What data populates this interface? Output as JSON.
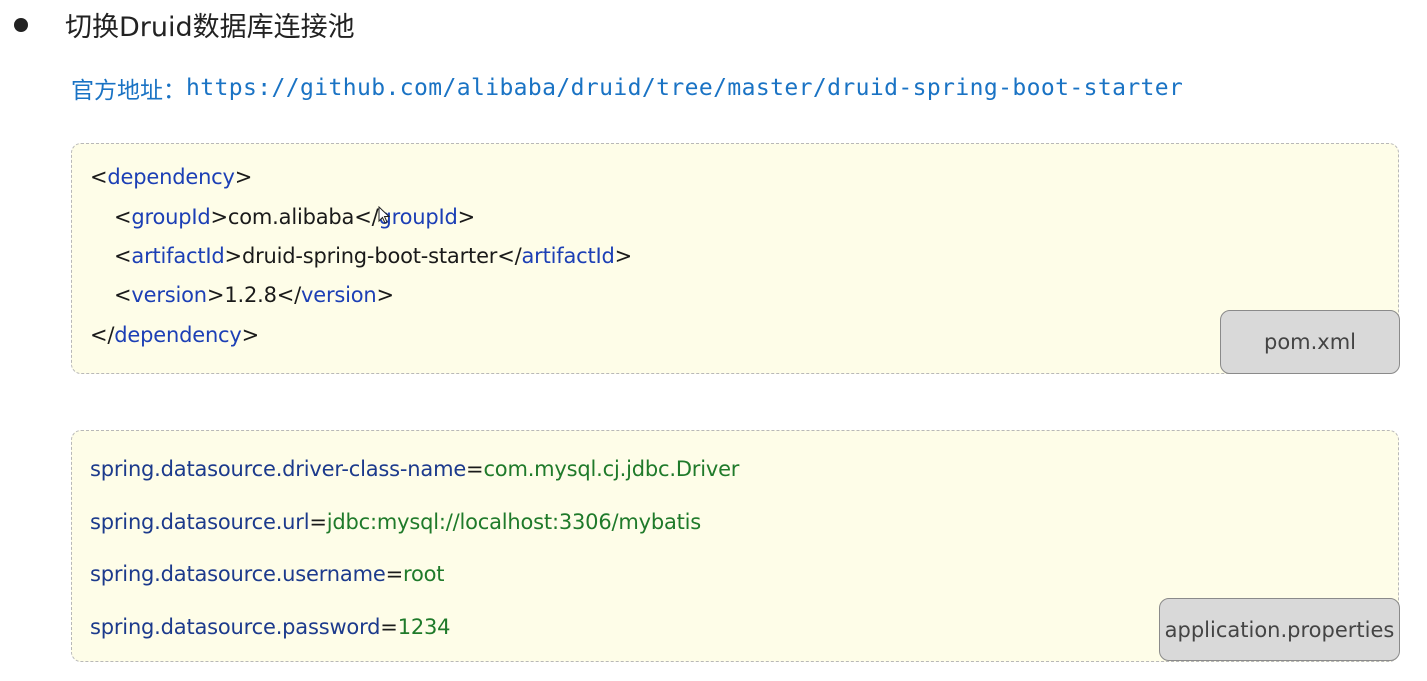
{
  "heading": {
    "text": "切换Druid数据库连接池"
  },
  "address": {
    "label": "官方地址：",
    "url": "https://github.com/alibaba/druid/tree/master/druid-spring-boot-starter"
  },
  "pom_block": {
    "file_label": "pom.xml",
    "lines": {
      "l1": {
        "open": "<",
        "tag": "dependency",
        "close": ">"
      },
      "l2": {
        "open": "<",
        "tag": "groupId",
        "mid": ">com.alibaba</",
        "tag2": "groupId",
        "close": ">"
      },
      "l3": {
        "open": "<",
        "tag": "artifactId",
        "mid": ">druid-spring-boot-starter</",
        "tag2": "artifactId",
        "close": ">"
      },
      "l4": {
        "open": "<",
        "tag": "version",
        "mid": ">1.2.8</",
        "tag2": "version",
        "close": ">"
      },
      "l5": {
        "open": "</",
        "tag": "dependency",
        "close": ">"
      }
    }
  },
  "properties_block": {
    "file_label": "application.properties",
    "lines": {
      "p1": {
        "key": "spring.datasource.driver-class-name",
        "eq": "=",
        "value": "com.mysql.cj.jdbc.Driver"
      },
      "p2": {
        "key": "spring.datasource.url",
        "eq": "=",
        "value": "jdbc:mysql://localhost:3306/mybatis"
      },
      "p3": {
        "key": "spring.datasource.username",
        "eq": "=",
        "value": "root"
      },
      "p4": {
        "key": "spring.datasource.password",
        "eq": "=",
        "value": "1234"
      }
    }
  },
  "colors": {
    "link": "#1a73c4",
    "xml_tag": "#1c3fb5",
    "prop_key": "#1c3a8c",
    "prop_value": "#1f7a2a",
    "code_bg": "#fefde8",
    "label_bg": "#d9d9d9"
  }
}
